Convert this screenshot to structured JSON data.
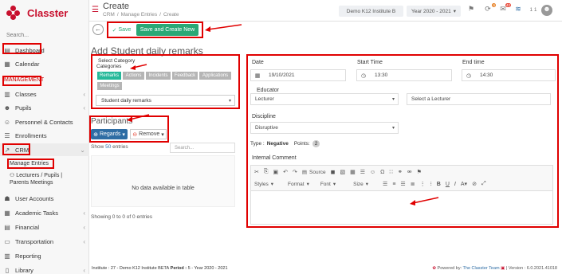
{
  "app": {
    "name": "Classter"
  },
  "sidebar": {
    "search_placeholder": "Search...",
    "items": {
      "dashboard": "Dashboard",
      "calendar": "Calendar",
      "management": "MANAGEMENT",
      "classes": "Classes",
      "pupils": "Pupils",
      "personnel": "Personnel & Contacts",
      "enrollments": "Enrollments",
      "crm": "CRM",
      "manage_entries": "Manage Entries",
      "lecturers": "Lecturers / Pupils |",
      "lecturers2": "Parents Meetings",
      "user_accounts": "User Accounts",
      "academic_tasks": "Academic Tasks",
      "financial": "Financial",
      "transportation": "Transportation",
      "reporting": "Reporting",
      "library": "Library"
    }
  },
  "header": {
    "title": "Create",
    "breadcrumb": [
      "CRM",
      "/",
      "Manage Entries",
      "/",
      "Create"
    ],
    "institute": "Demo K12 Institute B",
    "year": "Year 2020 - 2021",
    "counts": {
      "notifications": "6",
      "messages": "42",
      "page": "1 1"
    }
  },
  "toolbar": {
    "save": "Save",
    "save_create": "Save and Create New"
  },
  "form": {
    "title": "Add Student daily remarks",
    "select_category": "Select Category",
    "categories_label": "Categories",
    "categories": [
      "Remarks",
      "Actions",
      "Incidents",
      "Feedback",
      "Applications",
      "Meetings"
    ],
    "category_value": "Student daily remarks",
    "participants": "Participants",
    "regards": "Regards",
    "remove": "Remove",
    "show": "Show",
    "show_count": "50",
    "entries": "entries",
    "search_placeholder": "Search...",
    "no_data": "No data available in table",
    "showing": "Showing 0 to 0 of 0 entries"
  },
  "details": {
    "date_label": "Date",
    "date_value": "19/10/2021",
    "start_label": "Start Time",
    "start_value": "13:30",
    "end_label": "End time",
    "end_value": "14:30",
    "educator_label": "Educator",
    "educator_value": "Lecturer",
    "lecturer_placeholder": "Select a Lecturer",
    "discipline_label": "Discipline",
    "discipline_value": "Disruptive",
    "type_label": "Type :",
    "type_value": "Negative",
    "points_label": "Points:",
    "points_value": "2",
    "internal_comment": "Internal Comment",
    "source": "Source",
    "styles": "Styles",
    "format": "Format",
    "font": "Font",
    "size": "Size"
  },
  "footer": {
    "institute_label": "Institute :",
    "institute_value": "27 - Demo K12 Institute BETA",
    "period_label": "Period :",
    "period_value": "5 - Year 2020 - 2021",
    "powered": "Powered by:",
    "team": "The Classter Team",
    "version": "| Version : 6.0.2021.41018"
  },
  "colors": {
    "brand": "#c8102e",
    "accent": "#26b99a",
    "primary": "#2e6da4",
    "annotation": "#e00000"
  }
}
